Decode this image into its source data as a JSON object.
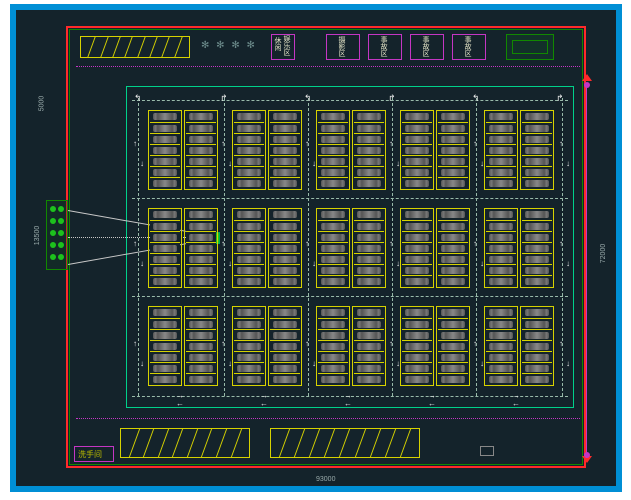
{
  "frame": {
    "border_color": "#008fd5",
    "bg": "#14232b"
  },
  "red_perimeter": {
    "color": "#ff2a2a"
  },
  "top_yellow_zone": {
    "slashes": 9,
    "label": ""
  },
  "top_decor": "✻ ✻ ✻ ✻",
  "zone_labels": {
    "a": "休闲",
    "a2": "娱乐区",
    "b": "摄影区",
    "c": "事故区",
    "d": "事故区",
    "e": "事故区"
  },
  "top_right_box": {
    "label": ""
  },
  "left_green_box": {
    "dots": 10
  },
  "dimensions": {
    "left_top": "5000",
    "left_mid": "13500",
    "right": "72000",
    "bottom": "93000"
  },
  "parking": {
    "bay_count": 10,
    "pairs": 5,
    "rows_per_bay": 7,
    "triple_row": true
  },
  "bottom_yellow_zones": {
    "left": {
      "slashes": 9
    },
    "right": {
      "slashes": 10
    }
  },
  "bottom_room": {
    "label": "洗手间"
  },
  "entry_markers": {
    "type": "triangle",
    "color": "#ff2a2a"
  },
  "robot": {
    "present": true
  }
}
